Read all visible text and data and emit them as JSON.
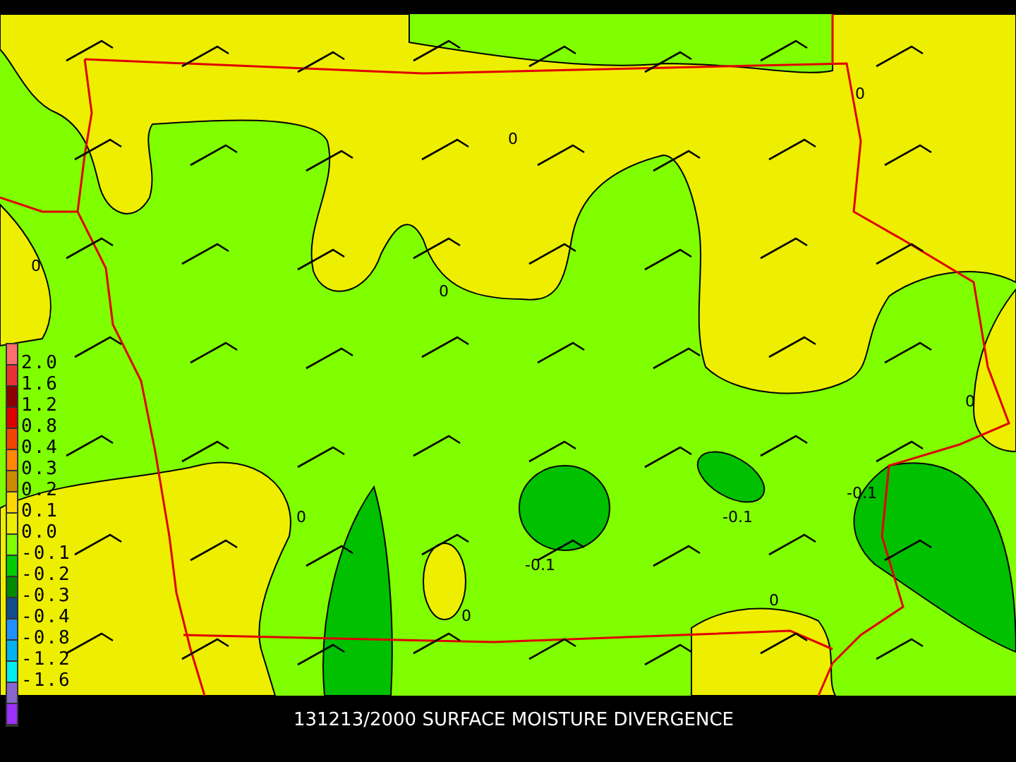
{
  "map": {
    "contour_labels": [
      "0",
      "0",
      "0",
      "0",
      "0",
      "0",
      "0",
      "0",
      "-0.1",
      "-0.1",
      "-0.1"
    ]
  },
  "legend": {
    "swatches": [
      {
        "color": "#ff6e6e"
      },
      {
        "color": "#e83232"
      },
      {
        "color": "#8b0000"
      },
      {
        "color": "#dc0000"
      },
      {
        "color": "#f04400"
      },
      {
        "color": "#ff8800"
      },
      {
        "color": "#cd8a00"
      },
      {
        "color": "#ffd700"
      },
      {
        "color": "#eeee00"
      },
      {
        "color": "#7fff00"
      },
      {
        "color": "#00cd00"
      },
      {
        "color": "#008b00"
      },
      {
        "color": "#104e8b"
      },
      {
        "color": "#1e90ff"
      },
      {
        "color": "#00b2ee"
      },
      {
        "color": "#00eeee"
      },
      {
        "color": "#8968cd"
      },
      {
        "color": "#9b30ff"
      }
    ],
    "labels": [
      "2.0",
      "1.6",
      "1.2",
      "0.8",
      "0.4",
      "0.3",
      "0.2",
      "0.1",
      "0.0",
      "-0.1",
      "-0.2",
      "-0.3",
      "-0.4",
      "-0.8",
      "-1.2",
      "-1.6"
    ]
  },
  "caption": "131213/2000 SURFACE MOISTURE DIVERGENCE"
}
